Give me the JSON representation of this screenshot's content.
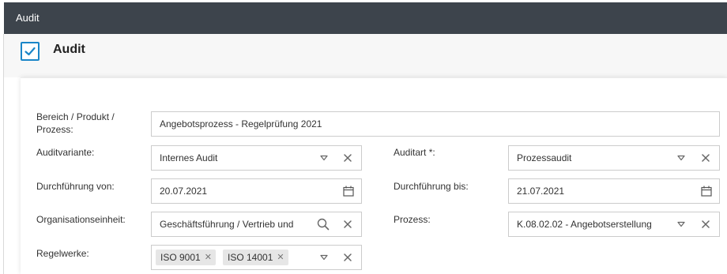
{
  "window": {
    "title": "Audit"
  },
  "header": {
    "title": "Audit",
    "checked": true
  },
  "form": {
    "bereich": {
      "label": "Bereich / Produkt / Prozess:",
      "value": "Angebotsprozess - Regelprüfung 2021"
    },
    "auditvariante": {
      "label": "Auditvariante:",
      "value": "Internes Audit"
    },
    "auditart": {
      "label": "Auditart *:",
      "value": "Prozessaudit"
    },
    "durchfuehrung_von": {
      "label": "Durchführung von:",
      "value": "20.07.2021"
    },
    "durchfuehrung_bis": {
      "label": "Durchführung bis:",
      "value": "21.07.2021"
    },
    "organisationseinheit": {
      "label": "Organisationseinheit:",
      "value": "Geschäftsführung / Vertrieb und"
    },
    "prozess": {
      "label": "Prozess:",
      "value": "K.08.02.02 - Angebotserstellung"
    },
    "regelwerke": {
      "label": "Regelwerke:",
      "tags": [
        "ISO 9001",
        "ISO 14001"
      ]
    }
  },
  "icons": {
    "dropdown": "chevron-down-icon",
    "clear": "close-icon",
    "calendar": "calendar-icon",
    "search": "search-icon",
    "remove_tag": "close-icon"
  },
  "colors": {
    "titlebar": "#3d444c",
    "accent": "#1a86c8"
  }
}
